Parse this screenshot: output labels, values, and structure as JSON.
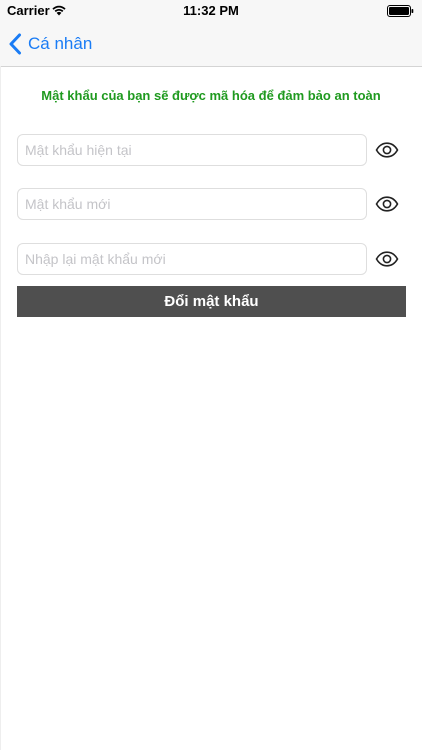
{
  "status_bar": {
    "carrier": "Carrier",
    "time": "11:32 PM",
    "wifi_icon": "wifi-icon",
    "battery_icon": "battery-full-icon"
  },
  "nav": {
    "back_label": "Cá nhân",
    "back_icon": "chevron-left-icon",
    "accent_color": "#1a7cf5"
  },
  "info": {
    "text": "Mật khẩu của bạn sẽ được mã hóa để đảm bảo an toàn",
    "color": "#1f9a1f"
  },
  "form": {
    "current_password": {
      "placeholder": "Mật khẩu hiện tại",
      "value": ""
    },
    "new_password": {
      "placeholder": "Mật khẩu mới",
      "value": ""
    },
    "confirm_password": {
      "placeholder": "Nhập lại mật khẩu mới",
      "value": ""
    },
    "toggle_icon": "eye-icon",
    "submit_label": "Đổi mật khẩu",
    "submit_color": "#4f4f4f"
  }
}
